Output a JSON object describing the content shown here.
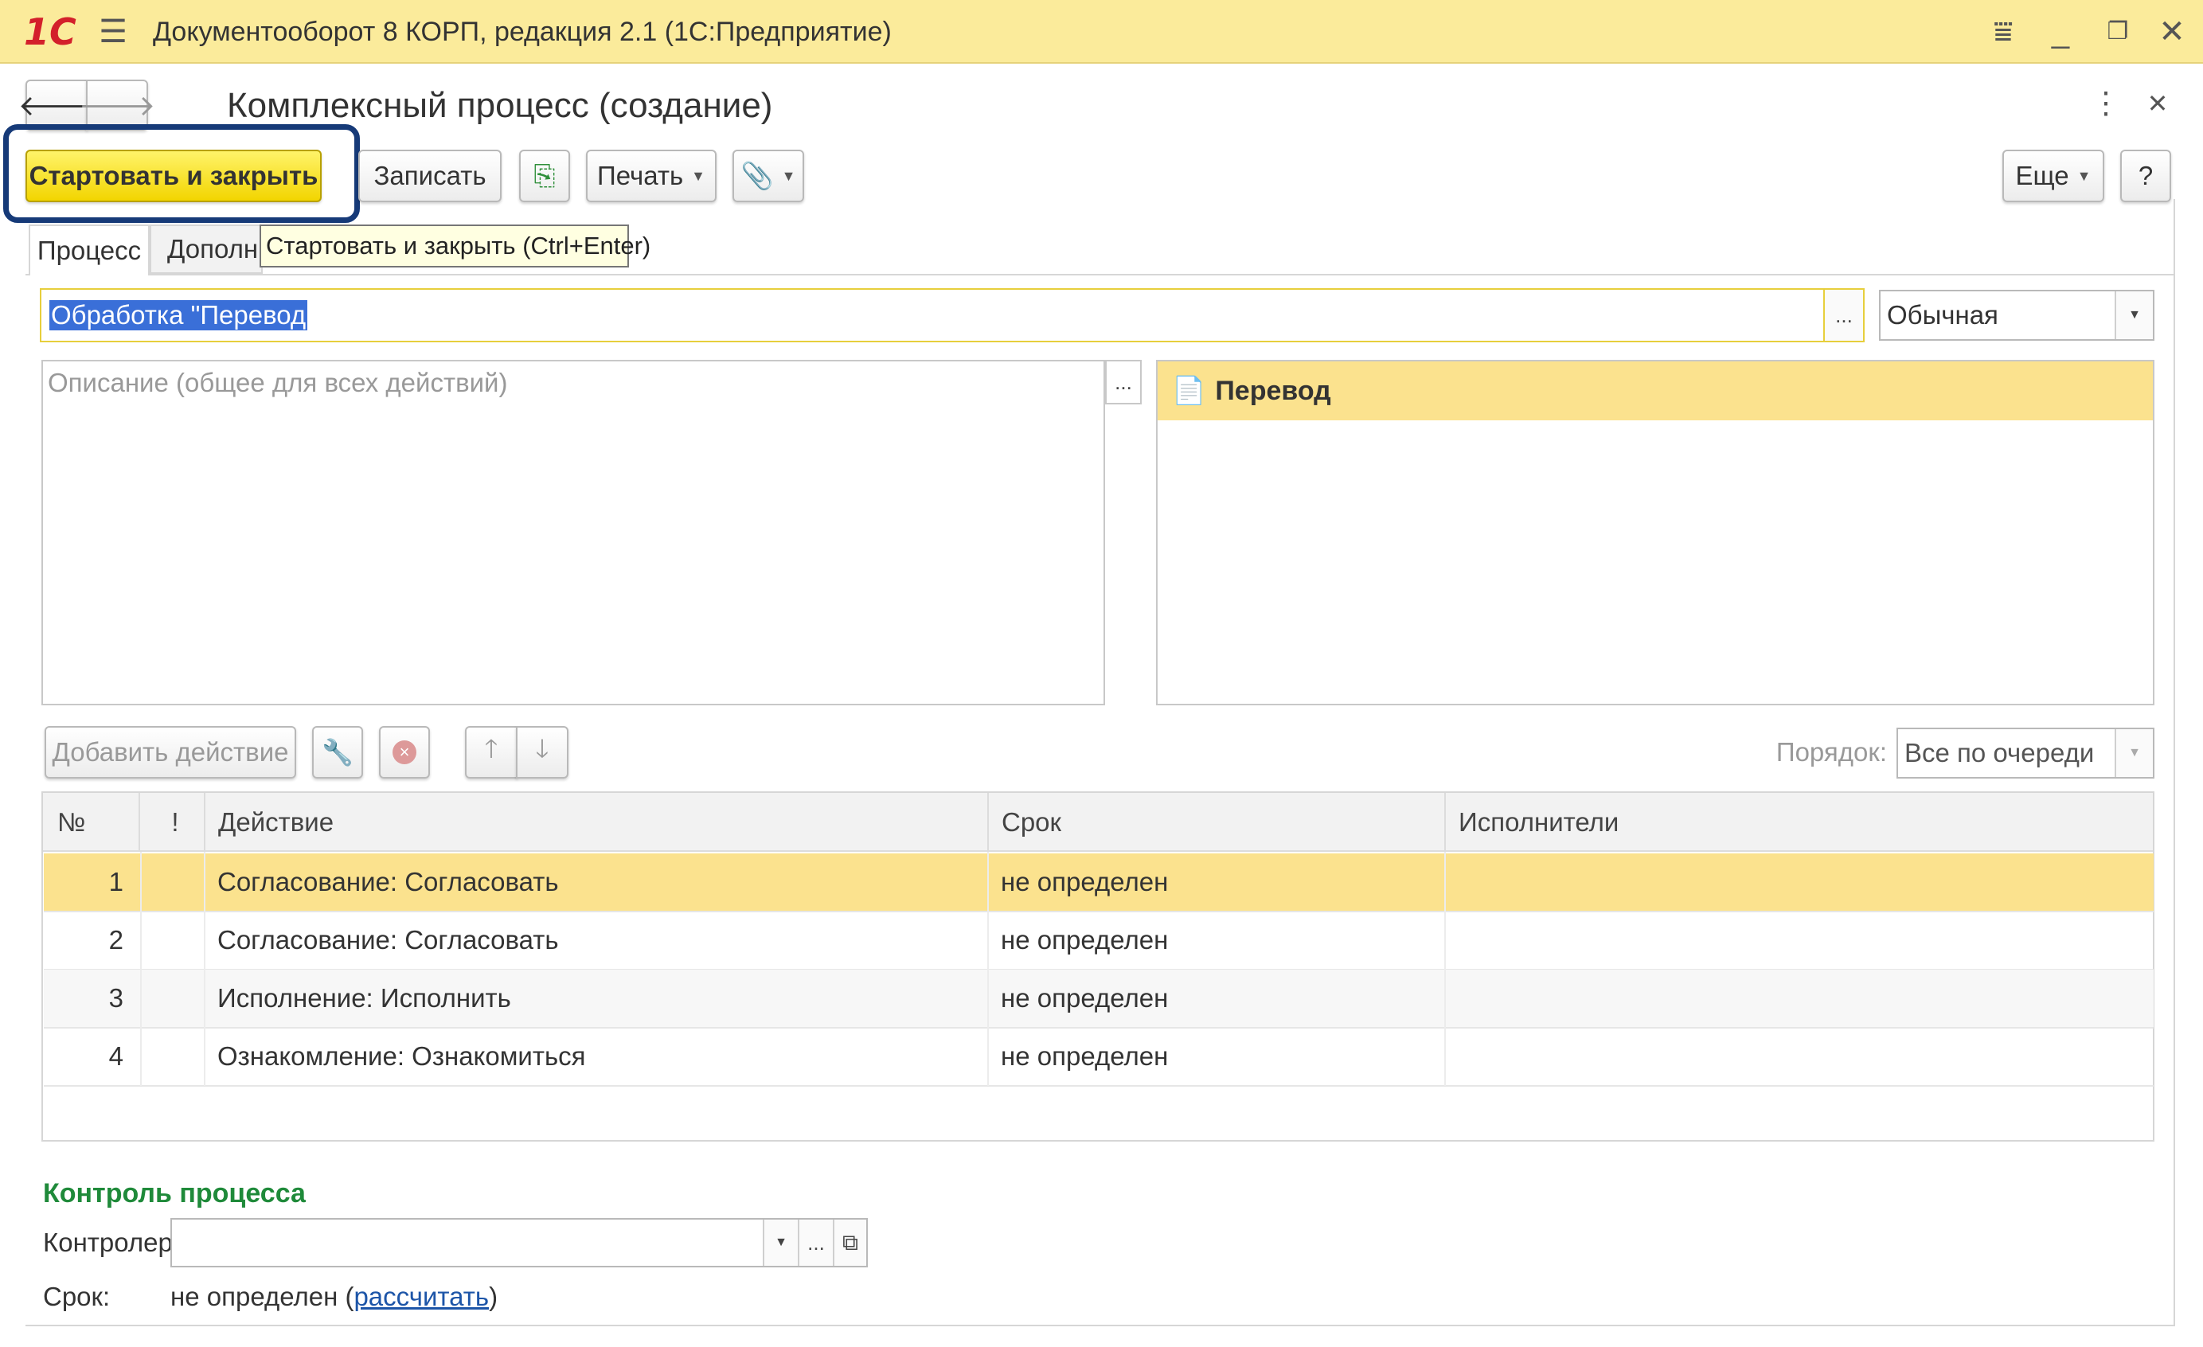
{
  "titlebar": {
    "logo": "1С",
    "app_title": "Документооборот 8 КОРП, редакция 2.1  (1С:Предприятие)"
  },
  "form": {
    "title": "Комплексный процесс (создание)",
    "toolbar": {
      "start_close": "Стартовать и закрыть",
      "save": "Записать",
      "print": "Печать",
      "more": "Еще",
      "help": "?"
    },
    "tooltip": "Стартовать и закрыть (Ctrl+Enter)",
    "tabs": [
      "Процесс",
      "Дополнит"
    ],
    "name_value": "Обработка \"Перевод",
    "importance": "Обычная",
    "description_placeholder": "Описание (общее для всех действий)",
    "subjects_item": "Перевод",
    "actions_toolbar": {
      "add_action": "Добавить действие",
      "order_label": "Порядок:",
      "order_value": "Все по очереди"
    },
    "table": {
      "columns": [
        "№",
        "!",
        "Действие",
        "Срок",
        "Исполнители"
      ],
      "rows": [
        {
          "num": "1",
          "action": "Согласование: Согласовать",
          "due": "не определен",
          "performers": ""
        },
        {
          "num": "2",
          "action": "Согласование: Согласовать",
          "due": "не определен",
          "performers": ""
        },
        {
          "num": "3",
          "action": "Исполнение: Исполнить",
          "due": "не определен",
          "performers": ""
        },
        {
          "num": "4",
          "action": "Ознакомление: Ознакомиться",
          "due": "не определен",
          "performers": ""
        }
      ]
    },
    "control": {
      "section_title": "Контроль процесса",
      "controller_label": "Контролер:",
      "controller_value": "",
      "due_label": "Срок:",
      "due_value": "не определен (",
      "recalc_link": "рассчитать",
      "due_close": ")"
    }
  },
  "colors": {
    "titlebar_bg": "#fbeb9b",
    "primary_button": "#f2d500",
    "selected_row": "#fbe28e",
    "highlight_frame": "#163a78",
    "section_title": "#1f8a3a",
    "link": "#1d55a8"
  }
}
